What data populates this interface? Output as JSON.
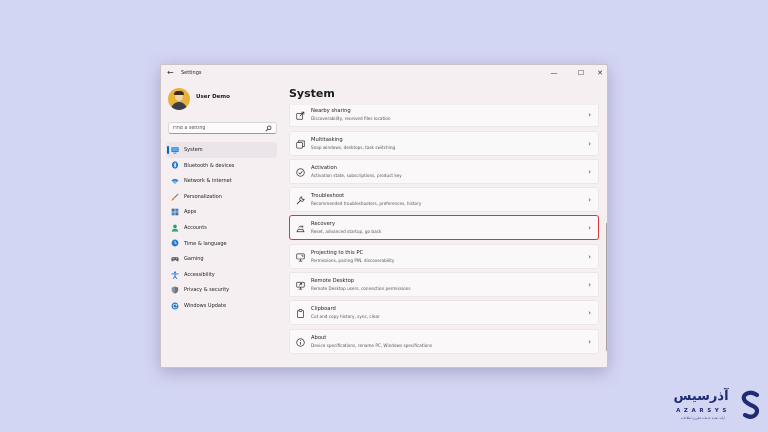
{
  "window": {
    "title": "Settings",
    "back_glyph": "←",
    "controls": {
      "minimize": "—",
      "maximize": "☐",
      "close": "✕"
    }
  },
  "sidebar": {
    "user_name": "User Demo",
    "search_placeholder": "Find a setting",
    "items": [
      {
        "label": "System",
        "icon": "monitor-icon",
        "active": true
      },
      {
        "label": "Bluetooth & devices",
        "icon": "bluetooth-icon"
      },
      {
        "label": "Network & internet",
        "icon": "wifi-icon"
      },
      {
        "label": "Personalization",
        "icon": "brush-icon"
      },
      {
        "label": "Apps",
        "icon": "apps-icon"
      },
      {
        "label": "Accounts",
        "icon": "person-icon"
      },
      {
        "label": "Time & language",
        "icon": "globe-clock-icon"
      },
      {
        "label": "Gaming",
        "icon": "gamepad-icon"
      },
      {
        "label": "Accessibility",
        "icon": "accessibility-icon"
      },
      {
        "label": "Privacy & security",
        "icon": "shield-icon"
      },
      {
        "label": "Windows Update",
        "icon": "update-icon"
      }
    ]
  },
  "main": {
    "title": "System",
    "items": [
      {
        "title": "Nearby sharing",
        "subtitle": "Discoverability, received files location",
        "icon": "share-icon"
      },
      {
        "title": "Multitasking",
        "subtitle": "Snap windows, desktops, task switching",
        "icon": "multitasking-icon"
      },
      {
        "title": "Activation",
        "subtitle": "Activation state, subscriptions, product key",
        "icon": "check-circle-icon"
      },
      {
        "title": "Troubleshoot",
        "subtitle": "Recommended troubleshooters, preferences, history",
        "icon": "wrench-icon"
      },
      {
        "title": "Recovery",
        "subtitle": "Reset, advanced startup, go back",
        "icon": "recovery-icon",
        "highlighted": true
      },
      {
        "title": "Projecting to this PC",
        "subtitle": "Permissions, pairing PIN, discoverability",
        "icon": "projector-icon"
      },
      {
        "title": "Remote Desktop",
        "subtitle": "Remote Desktop users, connection permissions",
        "icon": "remote-desktop-icon"
      },
      {
        "title": "Clipboard",
        "subtitle": "Cut and copy history, sync, clear",
        "icon": "clipboard-icon"
      },
      {
        "title": "About",
        "subtitle": "Device specifications, rename PC, Windows specifications",
        "icon": "info-icon"
      }
    ],
    "chevron": "›"
  },
  "watermark": {
    "arabic": "آذرسیس",
    "latin": "AZARSYS",
    "tagline": "ارائه دهنده خدمات فناوری اطلاعات",
    "colors": {
      "primary": "#1f2c73"
    }
  },
  "colors": {
    "background": "#d3d6f3",
    "window": "#f5eff2",
    "accent": "#0067c0",
    "highlight_border": "#d23a3a"
  }
}
